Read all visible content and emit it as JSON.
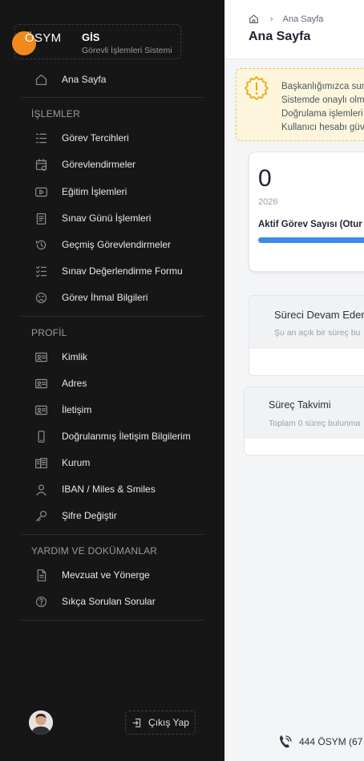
{
  "brand": {
    "logo_text": "ÖSYM",
    "app_name": "GİS",
    "app_subtitle": "Görevli İşlemleri Sistemi"
  },
  "sidebar": {
    "home": "Ana Sayfa",
    "sections": [
      {
        "title": "İŞLEMLER",
        "items": [
          {
            "label": "Görev Tercihleri",
            "icon": "list-icon"
          },
          {
            "label": "Görevlendirmeler",
            "icon": "calendar-icon"
          },
          {
            "label": "Eğitim İşlemleri",
            "icon": "video-icon"
          },
          {
            "label": "Sınav Günü İşlemleri",
            "icon": "clipboard-icon"
          },
          {
            "label": "Geçmiş Görevlendirmeler",
            "icon": "history-icon"
          },
          {
            "label": "Sınav Değerlendirme Formu",
            "icon": "checklist-icon"
          },
          {
            "label": "Görev İhmal Bilgileri",
            "icon": "sad-face-icon"
          }
        ]
      },
      {
        "title": "PROFİL",
        "items": [
          {
            "label": "Kimlik",
            "icon": "id-card-icon"
          },
          {
            "label": "Adres",
            "icon": "id-card-icon"
          },
          {
            "label": "İletişim",
            "icon": "id-card-icon"
          },
          {
            "label": "Doğrulanmış İletişim Bilgilerim",
            "icon": "mobile-icon"
          },
          {
            "label": "Kurum",
            "icon": "building-icon"
          },
          {
            "label": "IBAN / Miles & Smiles",
            "icon": "user-icon"
          },
          {
            "label": "Şifre Değiştir",
            "icon": "key-icon"
          }
        ]
      },
      {
        "title": "YARDIM VE DOKÜMANLAR",
        "items": [
          {
            "label": "Mevzuat ve Yönerge",
            "icon": "document-icon"
          },
          {
            "label": "Sıkça Sorulan Sorular",
            "icon": "question-icon"
          }
        ]
      }
    ],
    "logout": "Çıkış Yap"
  },
  "header": {
    "breadcrumb": "Ana Sayfa",
    "title": "Ana Sayfa"
  },
  "alert": {
    "lines": [
      "Başkanlığımızca sun",
      "Sistemde onaylı olm",
      "Doğrulama işlemleri",
      "Kullanıcı hesabı güv"
    ]
  },
  "stat": {
    "value": "0",
    "year": "2026",
    "label": "Aktif Görev Sayısı (Otur"
  },
  "processes": {
    "ongoing_title": "Süreci Devam Eden",
    "ongoing_sub": "Şu an açık bir süreç bu",
    "calendar_title": "Süreç Takvimi",
    "calendar_sub": "Toplam 0 süreç bulunma"
  },
  "footer": {
    "phone": "444 ÖSYM (67"
  },
  "colors": {
    "sidebar_bg": "#161616",
    "brand_orange": "#f08a1c",
    "progress_blue": "#3b8ae8",
    "alert_bg": "#fdf6dc",
    "alert_accent": "#e8a91a"
  }
}
